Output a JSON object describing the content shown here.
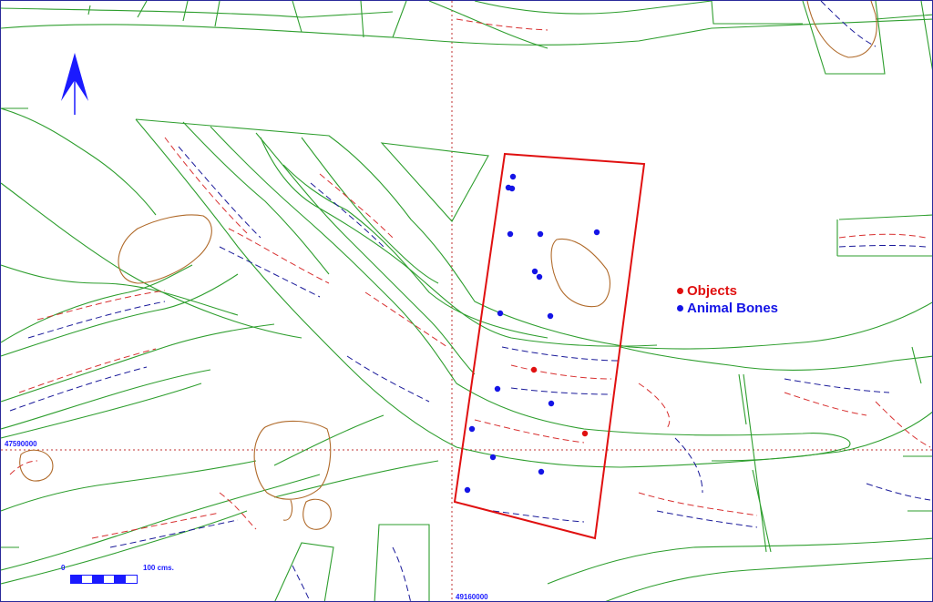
{
  "colors": {
    "background": "#ffffff",
    "frame": "#2a2a9a",
    "vegetation_line": "#2e9e2e",
    "contour_red": "#d83030",
    "contour_blue": "#1a1a9a",
    "feature_outline": "#b06a2a",
    "trench_outline": "#e01010",
    "grid_line": "#c03030",
    "north_arrow": "#1a1aff",
    "objects": "#e01010",
    "animal_bones": "#1414e6",
    "coord_text": "#1a1aff",
    "scale": "#1a1aff"
  },
  "north_arrow": {
    "icon": "north-arrow-icon"
  },
  "legend": {
    "items": [
      {
        "label": "Objects",
        "color": "#e01010"
      },
      {
        "label": "Animal Bones",
        "color": "#1414e6"
      }
    ]
  },
  "scale": {
    "zero": "0",
    "label": "100 cms.",
    "segments": [
      true,
      false,
      true,
      false,
      true,
      false
    ]
  },
  "coordinates": {
    "horizontal_gridline": "47590000",
    "vertical_gridline": "49160000"
  }
}
